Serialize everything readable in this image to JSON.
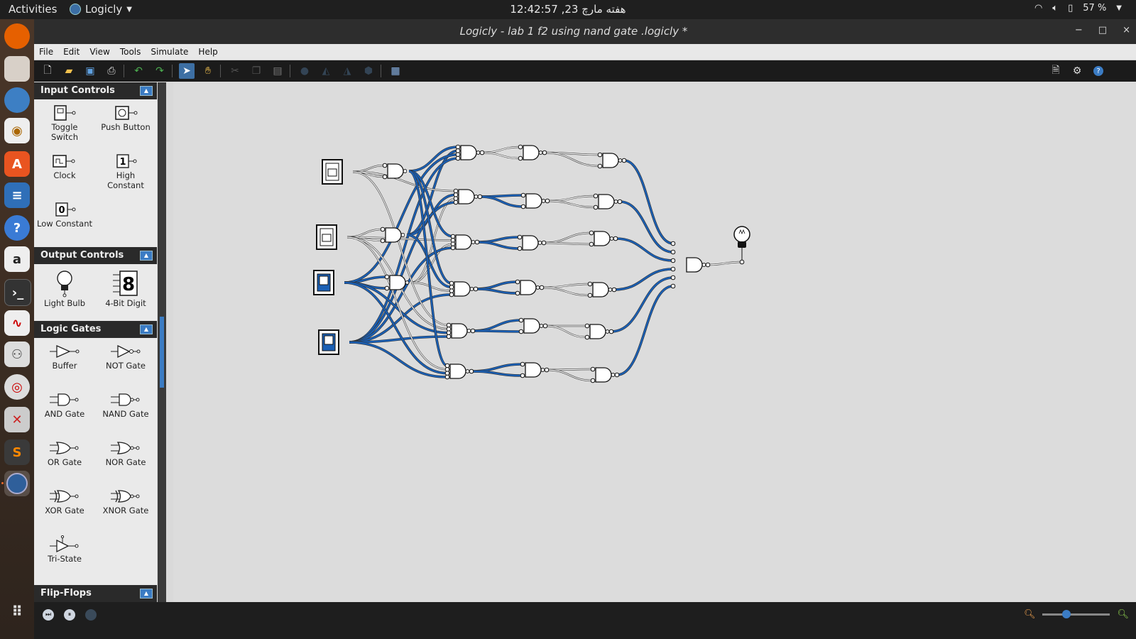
{
  "topbar": {
    "activities": "Activities",
    "app_name": "Logicly",
    "clock": "هفته مارچ 23, 12:42:57",
    "battery": "57 %"
  },
  "window": {
    "title": "Logicly - lab 1 f2 using nand gate  .logicly *",
    "minimize": "−",
    "maximize": "□",
    "close": "×"
  },
  "menu": [
    "File",
    "Edit",
    "View",
    "Tools",
    "Simulate",
    "Help"
  ],
  "palette": {
    "input_controls": {
      "header": "Input Controls",
      "items": [
        {
          "label": "Toggle Switch"
        },
        {
          "label": "Push Button"
        },
        {
          "label": "Clock"
        },
        {
          "label": "High Constant"
        },
        {
          "label": "Low Constant"
        }
      ],
      "high_glyph": "1",
      "low_glyph": "0"
    },
    "output_controls": {
      "header": "Output Controls",
      "items": [
        {
          "label": "Light Bulb"
        },
        {
          "label": "4-Bit Digit"
        }
      ],
      "digit_glyph": "8"
    },
    "logic_gates": {
      "header": "Logic Gates",
      "items": [
        {
          "label": "Buffer"
        },
        {
          "label": "NOT Gate"
        },
        {
          "label": "AND Gate"
        },
        {
          "label": "NAND Gate"
        },
        {
          "label": "OR Gate"
        },
        {
          "label": "NOR Gate"
        },
        {
          "label": "XOR Gate"
        },
        {
          "label": "XNOR Gate"
        },
        {
          "label": "Tri-State"
        }
      ]
    },
    "flip_flops": {
      "header": "Flip-Flops"
    }
  },
  "colors": {
    "wire_active": "#1a5fb4",
    "wire_inactive": "#ffffff",
    "accent": "#3b7cc4",
    "canvas": "#dcdcdc"
  },
  "circuit": {
    "switch_states": [
      "off",
      "off",
      "on",
      "on"
    ],
    "output_bulb": "off"
  }
}
